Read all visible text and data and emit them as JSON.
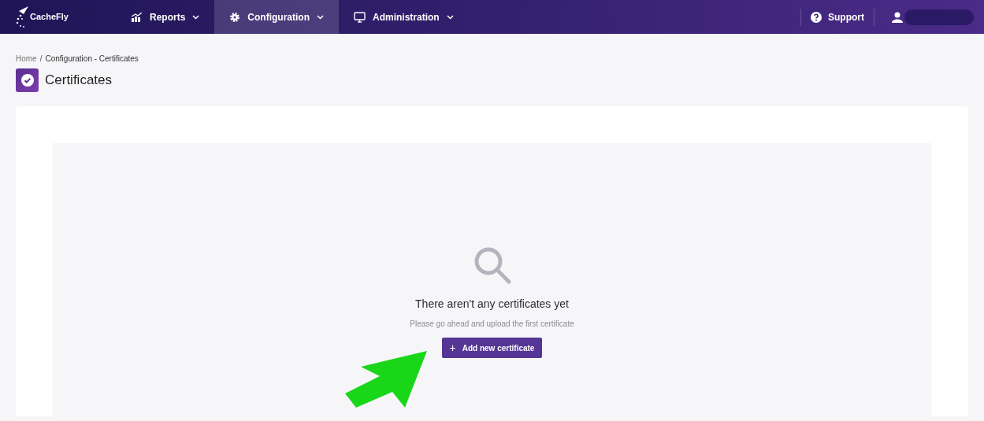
{
  "nav": {
    "logo": "CacheFly",
    "items": [
      {
        "label": "Reports",
        "selected": false
      },
      {
        "label": "Configuration",
        "selected": true
      },
      {
        "label": "Administration",
        "selected": false
      }
    ],
    "support": "Support"
  },
  "breadcrumb": {
    "items": [
      "Home",
      "Configuration - Certificates"
    ],
    "separator": "/"
  },
  "page_title": "Certificates",
  "empty_state": {
    "heading": "There aren't any certificates yet",
    "message": "Please go ahead and upload the first certificate",
    "button": {
      "icon": "+",
      "label": "Add new certificate"
    }
  }
}
